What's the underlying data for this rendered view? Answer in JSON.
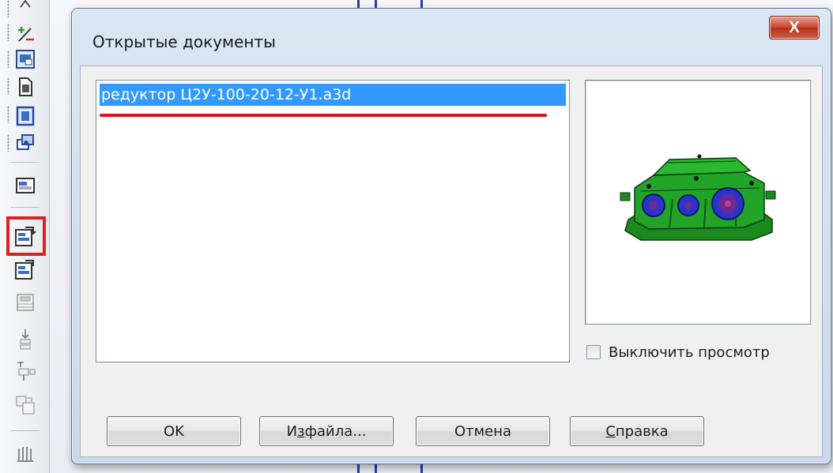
{
  "dialog": {
    "title": "Открытые документы",
    "close_label": "X"
  },
  "documents": {
    "items": [
      {
        "label": "редуктор Ц2У-100-20-12-У1.a3d",
        "selected": true
      }
    ]
  },
  "preview": {
    "disable_label": "Выключить просмотр",
    "disable_checked": false
  },
  "buttons": {
    "ok": "OK",
    "from_file_pre": "Из",
    "from_file_post": " файла...",
    "from_file_mnemonic": "з",
    "from_file_prefix": "И",
    "cancel": "Отмена",
    "help_mnemonic": "С",
    "help_rest": "правка"
  },
  "toolbar": {
    "icons": [
      "arrow-icon",
      "plus-minus-icon",
      "view-window-icon",
      "document-icon",
      "frame-icon",
      "layers-icon",
      "panel-icon",
      "windows-switch-icon",
      "windows-next-icon",
      "grid-panel-icon",
      "insert-icon",
      "insert-component-icon",
      "resize-icon",
      "library-icon"
    ]
  },
  "colors": {
    "selection": "#3399ff",
    "highlight": "#e02020",
    "model_body": "#1f9e24",
    "model_gear": "#2a34c8"
  }
}
